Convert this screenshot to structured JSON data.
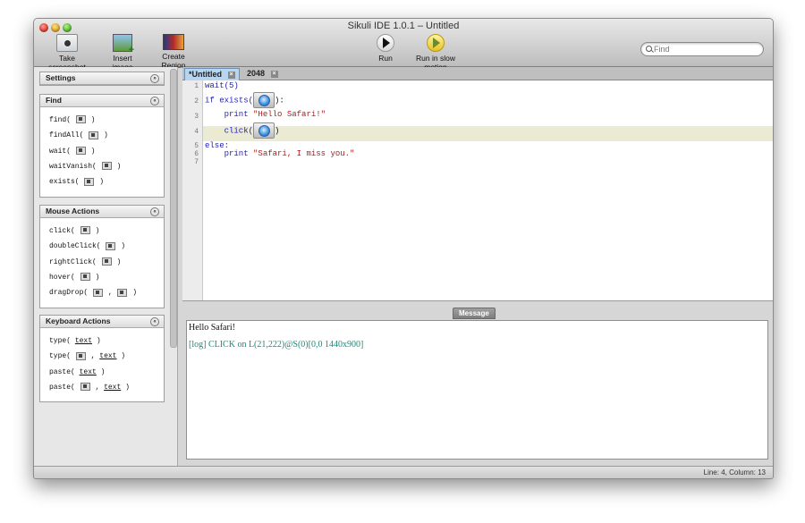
{
  "window": {
    "title": "Sikuli IDE 1.0.1 – Untitled"
  },
  "toolbar": {
    "take_screenshot": "Take screenshot",
    "insert_image": "Insert image",
    "create_region": "Create Region",
    "run": "Run",
    "run_slow": "Run in slow motion"
  },
  "search": {
    "placeholder": "Find"
  },
  "sidebar": {
    "settings": {
      "title": "Settings",
      "chevron": "»"
    },
    "find": {
      "title": "Find",
      "chevron": "«",
      "items": [
        "find(",
        "findAll(",
        "wait(",
        "waitVanish(",
        "exists("
      ]
    },
    "mouse": {
      "title": "Mouse Actions",
      "chevron": "«",
      "items": [
        "click(",
        "doubleClick(",
        "rightClick(",
        "hover(",
        "dragDrop("
      ]
    },
    "keyboard": {
      "title": "Keyboard Actions",
      "chevron": "«",
      "items": [
        "type(",
        "type(",
        "paste(",
        "paste("
      ]
    },
    "close_paren": ")",
    "comma": ",",
    "text_arg": "text"
  },
  "tabs": [
    {
      "label": "*Untitled",
      "close": "×"
    },
    {
      "label": "2048",
      "close": "×"
    }
  ],
  "editor": {
    "line_numbers": [
      "1",
      "2",
      "3",
      "4",
      "5",
      "6",
      "7"
    ],
    "l1": "wait(5)",
    "l2_kw": "if",
    "l2_fn": "exists(",
    "l2_end": "):",
    "l3_kw": "print",
    "l3_str": "\"Hello Safari!\"",
    "l4_fn": "click(",
    "l4_end": ")",
    "l5": "else:",
    "l6_kw": "print",
    "l6_str": "\"Safari, I miss you.\""
  },
  "message": {
    "tab": "Message",
    "line1": "Hello Safari!",
    "line2": "[log] CLICK on L(21,222)@S(0)[0,0 1440x900]",
    "log_color": "#1a8a7a"
  },
  "status": {
    "text": "Line: 4, Column: 13"
  },
  "colors": {
    "keyword": "#1d1db5",
    "string": "#b01a1a",
    "current_line": "#ebebd3"
  }
}
